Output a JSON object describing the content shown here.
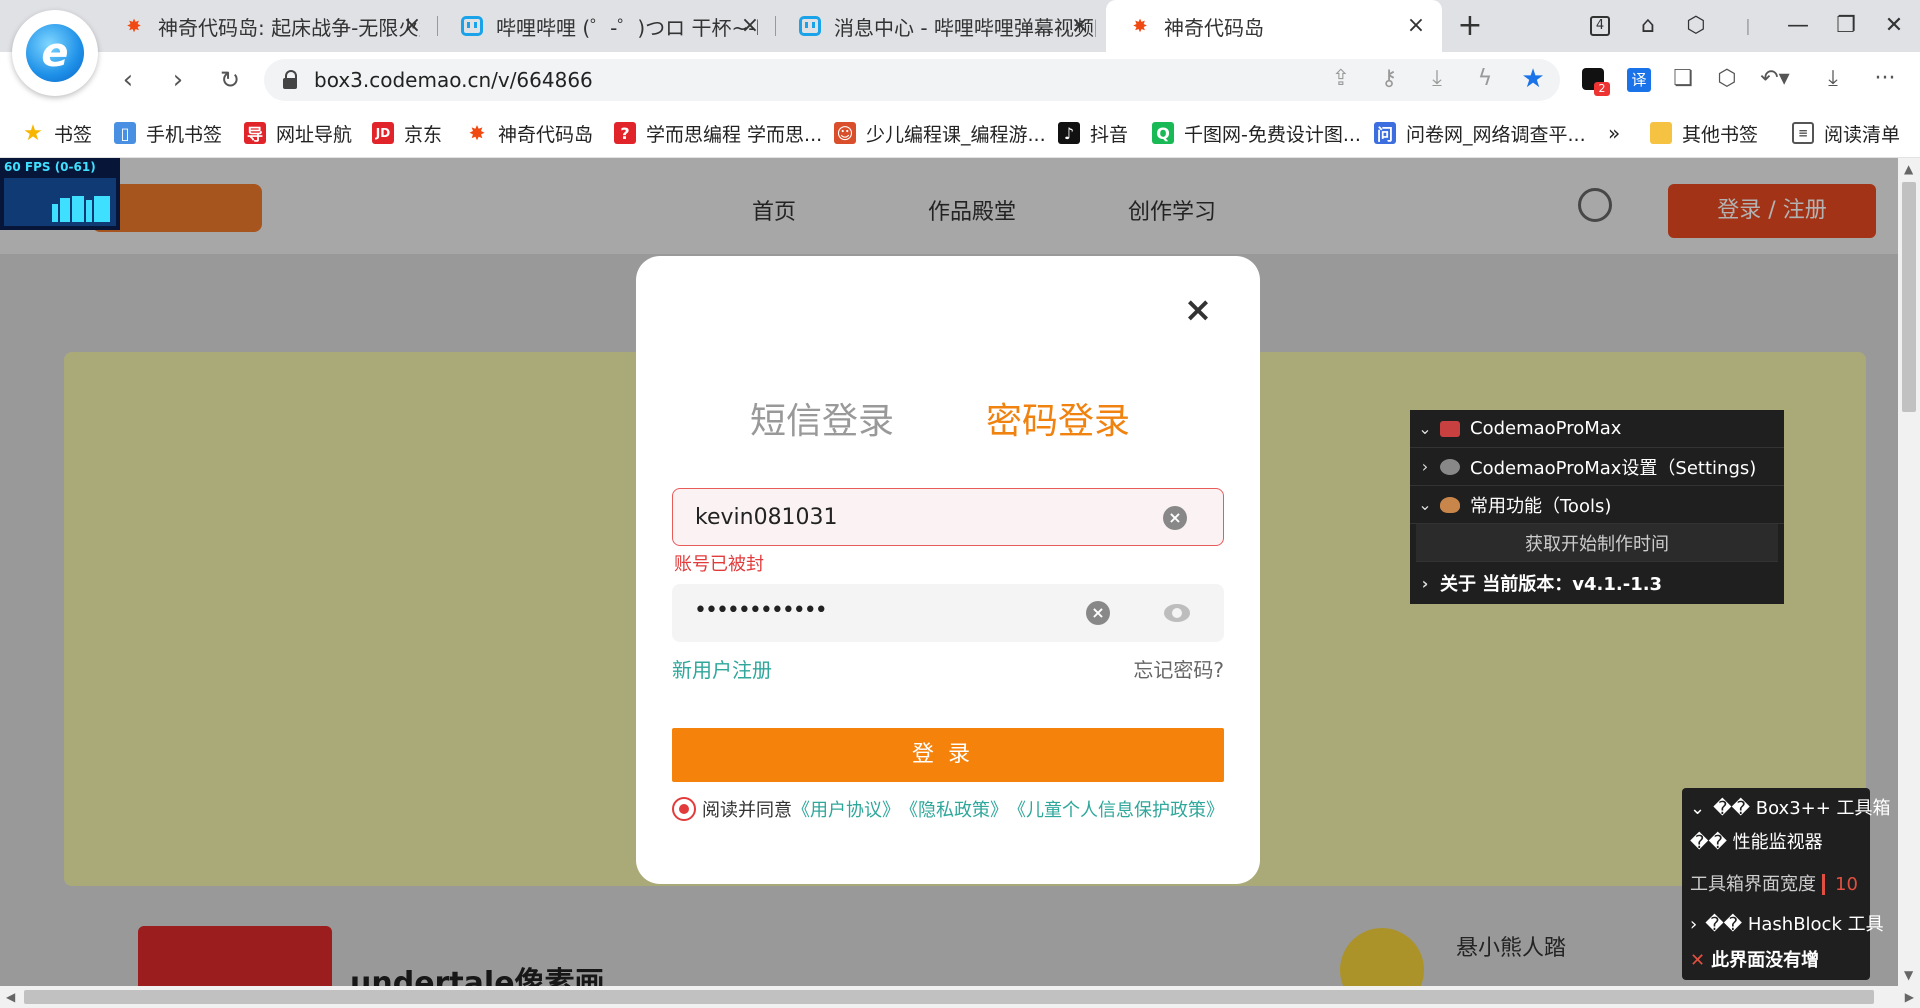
{
  "browser": {
    "tabs": [
      {
        "title": "神奇代码岛: 起床战争-无限火力",
        "icon": "star-icon",
        "active": false
      },
      {
        "title": "哔哩哔哩 (゜-゜)つロ 干杯~-bilibili",
        "icon": "bilibili-icon",
        "active": false
      },
      {
        "title": "消息中心 - 哔哩哔哩弹幕视频网",
        "icon": "bilibili-icon",
        "active": false
      },
      {
        "title": "神奇代码岛",
        "icon": "star-icon",
        "active": true
      }
    ],
    "tab_count_badge": "4",
    "address": "box3.codemao.cn/v/664866",
    "extension_badge": "2",
    "translate_label": "译",
    "bookmarks": [
      {
        "label": "书签",
        "icon": "star-icon",
        "color": "#f7b500"
      },
      {
        "label": "手机书签",
        "icon": "phone-icon",
        "color": "#4a90e2"
      },
      {
        "label": "网址导航",
        "icon": "nav-icon",
        "color": "#e0242a"
      },
      {
        "label": "京东",
        "icon": "jd-icon",
        "color": "#e0242a"
      },
      {
        "label": "神奇代码岛",
        "icon": "star-icon",
        "color": "#f04a12"
      },
      {
        "label": "学而思编程 学而思...",
        "icon": "xes-icon",
        "color": "#e0242a"
      },
      {
        "label": "少儿编程课_编程游...",
        "icon": "kids-icon",
        "color": "#d94f2b"
      },
      {
        "label": "抖音",
        "icon": "douyin-icon",
        "color": "#111111"
      },
      {
        "label": "千图网-免费设计图...",
        "icon": "qiantu-icon",
        "color": "#19b955"
      },
      {
        "label": "问卷网_网络调查平...",
        "icon": "wenjuan-icon",
        "color": "#3c6ee0"
      }
    ],
    "bookmarks_more": "»",
    "other_bookmarks": "其他书签",
    "reading_list": "阅读清单"
  },
  "fps_meter": {
    "label": "60 FPS (0-61)"
  },
  "site": {
    "nav": [
      "首页",
      "作品殿堂",
      "创作学习"
    ],
    "login_register": "登录 / 注册",
    "card_title": "undertale像素画",
    "author": "悬小熊人踏"
  },
  "login_modal": {
    "close": "×",
    "tab_sms": "短信登录",
    "tab_password": "密码登录",
    "username": "kevin081031",
    "error": "账号已被封",
    "password_mask": "••••••••••••",
    "register_link": "新用户注册",
    "forgot_link": "忘记密码?",
    "login_button": "登录",
    "agree_text": "阅读并同意",
    "agree_links": [
      "《用户协议》",
      "《隐私政策》",
      "《儿童个人信息保护政策》"
    ]
  },
  "promax_panel": {
    "rows": [
      {
        "chevron": "⌄",
        "label": "CodemaoProMax"
      },
      {
        "chevron": "›",
        "label": "CodemaoProMax设置（Settings)"
      },
      {
        "chevron": "⌄",
        "label": "常用功能（Tools)"
      },
      {
        "chevron": "",
        "label": "获取开始制作时间"
      },
      {
        "chevron": "›",
        "label": "关于 当前版本：v4.1.-1.3"
      }
    ]
  },
  "box3_panel": {
    "title": "�� Box3++ 工具箱",
    "monitor": "�� 性能监视器",
    "width_label": "工具箱界面宽度",
    "width_value": "10",
    "hashblock": "�� HashBlock 工具",
    "no_add": "此界面没有增"
  }
}
